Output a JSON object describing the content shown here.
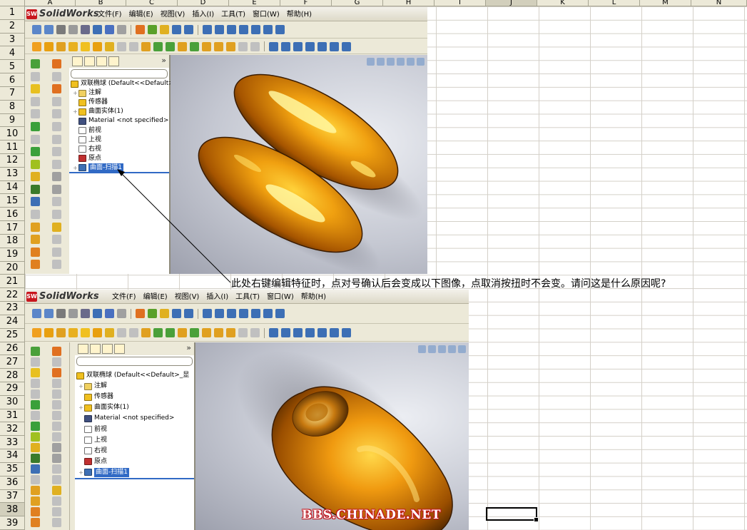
{
  "spreadsheet": {
    "columns": [
      "A",
      "B",
      "C",
      "D",
      "E",
      "F",
      "G",
      "H",
      "I",
      "J",
      "K",
      "L",
      "M",
      "N"
    ],
    "selected_column": "J",
    "rows": [
      "1",
      "2",
      "3",
      "4",
      "5",
      "6",
      "7",
      "8",
      "9",
      "10",
      "11",
      "12",
      "13",
      "14",
      "15",
      "16",
      "17",
      "18",
      "19",
      "20",
      "21",
      "22",
      "23",
      "24",
      "25",
      "26",
      "27",
      "28",
      "29",
      "30",
      "31",
      "32",
      "33",
      "34",
      "35",
      "36",
      "37",
      "38",
      "39"
    ],
    "selected_row": "38",
    "note_text": "此处右键编辑特征时，点对号确认后会变成以下图像，点取消按扭时不会变。请问这是什么原因呢?"
  },
  "screenshots": [
    {
      "app_name": "SolidWorks",
      "menus": [
        "文件(F)",
        "编辑(E)",
        "视图(V)",
        "插入(I)",
        "工具(T)",
        "窗口(W)",
        "帮助(H)"
      ],
      "tree": {
        "root": "双联椭球 (Default<<Default>_显",
        "items": [
          {
            "label": "注解",
            "icon": "annotations-icon",
            "expander": "+"
          },
          {
            "label": "传感器",
            "icon": "sensors-icon",
            "expander": ""
          },
          {
            "label": "曲面实体(1)",
            "icon": "surface-bodies-icon",
            "expander": "+"
          },
          {
            "label": "Material <not specified>",
            "icon": "material-icon",
            "expander": ""
          },
          {
            "label": "前视",
            "icon": "plane-icon",
            "expander": ""
          },
          {
            "label": "上视",
            "icon": "plane-icon",
            "expander": ""
          },
          {
            "label": "右视",
            "icon": "plane-icon",
            "expander": ""
          },
          {
            "label": "原点",
            "icon": "origin-icon",
            "expander": ""
          },
          {
            "label": "曲面-扫描1",
            "icon": "sweep-icon",
            "expander": "+",
            "selected": true
          }
        ]
      }
    },
    {
      "app_name": "SolidWorks",
      "menus": [
        "文件(F)",
        "编辑(E)",
        "视图(V)",
        "插入(I)",
        "工具(T)",
        "窗口(W)",
        "帮助(H)"
      ],
      "tree": {
        "root": "双联椭球 (Default<<Default>_显",
        "items": [
          {
            "label": "注解",
            "icon": "annotations-icon",
            "expander": "+"
          },
          {
            "label": "传感器",
            "icon": "sensors-icon",
            "expander": ""
          },
          {
            "label": "曲面实体(1)",
            "icon": "surface-bodies-icon",
            "expander": "+"
          },
          {
            "label": "Material <not specified>",
            "icon": "material-icon",
            "expander": ""
          },
          {
            "label": "前视",
            "icon": "plane-icon",
            "expander": ""
          },
          {
            "label": "上视",
            "icon": "plane-icon",
            "expander": ""
          },
          {
            "label": "右视",
            "icon": "plane-icon",
            "expander": ""
          },
          {
            "label": "原点",
            "icon": "origin-icon",
            "expander": ""
          },
          {
            "label": "曲面-扫描1",
            "icon": "sweep-icon",
            "expander": "+",
            "selected": true
          }
        ]
      }
    }
  ],
  "watermark": "BBS.CHINADE.NET",
  "colors": {
    "model_orange": "#e8900c",
    "model_dark": "#5a2c00",
    "selection_blue": "#316ac5",
    "sw_red": "#c8161d"
  }
}
